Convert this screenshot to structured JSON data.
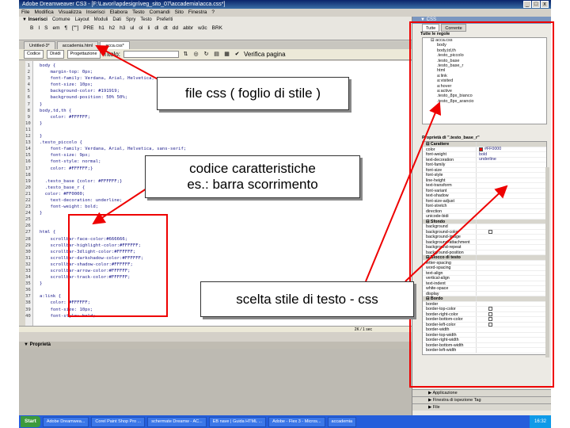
{
  "window": {
    "title": "Adobe Dreamweaver CS3 - [F:\\Lavori\\apdesign\\veg_sito_07\\accademia\\acca.css*]",
    "controls": [
      "_",
      "□",
      "x"
    ]
  },
  "menubar": [
    "File",
    "Modifica",
    "Visualizza",
    "Inserisci",
    "Elabora",
    "Testo",
    "Comandi",
    "Sito",
    "Finestra",
    "?"
  ],
  "insertbar": {
    "title": "▼ Inserisci",
    "tabs": [
      "Comune",
      "Layout",
      "Moduli",
      "Dati",
      "Spry",
      "Testo",
      "Preferiti"
    ],
    "icons": [
      "B",
      "I",
      "S",
      "em",
      "¶",
      "[\"\"]",
      "PRE",
      "h1",
      "h2",
      "h3",
      "ul",
      "ol",
      "li",
      "dl",
      "dt",
      "dd",
      "abbr",
      "w3c",
      "BRK"
    ]
  },
  "doc_tabs": [
    "Untitled-3*",
    "accademia.html",
    "acca.css*"
  ],
  "doc_toolbar": {
    "views": [
      "Codice",
      "Dividi",
      "Progettazione"
    ],
    "title_label": "Titolo:",
    "validate_label": "Verifica pagina"
  },
  "code_lines": [
    {
      "n": "1",
      "t": "body {"
    },
    {
      "n": "2",
      "t": "    margin-top: 0px;"
    },
    {
      "n": "3",
      "t": "    font-family: Verdana, Arial, Helvetica;"
    },
    {
      "n": "4",
      "t": "    font-size: 10px;"
    },
    {
      "n": "5",
      "t": "    background-color: #191919;"
    },
    {
      "n": "6",
      "t": "    background-position: 50% 50%;"
    },
    {
      "n": "7",
      "t": "}"
    },
    {
      "n": "8",
      "t": "body,td,th {"
    },
    {
      "n": "9",
      "t": "    color: #FFFFFF;"
    },
    {
      "n": "10",
      "t": "}"
    },
    {
      "n": "11",
      "t": ""
    },
    {
      "n": "12",
      "t": "}"
    },
    {
      "n": "13",
      "t": ".testo_piccolo {"
    },
    {
      "n": "14",
      "t": "    font-family: Verdana, Arial, Helvetica, sans-serif;"
    },
    {
      "n": "15",
      "t": "    font-size: 9px;"
    },
    {
      "n": "16",
      "t": "    font-style: normal;"
    },
    {
      "n": "17",
      "t": "    color: #FFFFFF;}"
    },
    {
      "n": "18",
      "t": ""
    },
    {
      "n": "19",
      "t": "  .testo_base {color: #FFFFFF;}"
    },
    {
      "n": "20",
      "t": "  .testo_base_r {"
    },
    {
      "n": "21",
      "t": "  color: #FF0000;"
    },
    {
      "n": "22",
      "t": "    text-decoration: underline;"
    },
    {
      "n": "23",
      "t": "    font-weight: bold;"
    },
    {
      "n": "24",
      "t": "}"
    },
    {
      "n": "25",
      "t": ""
    },
    {
      "n": "26",
      "t": ""
    },
    {
      "n": "27",
      "t": "html {"
    },
    {
      "n": "28",
      "t": "    scrollbar-face-color:#666666;"
    },
    {
      "n": "29",
      "t": "    scrollbar-highlight-color:#FFFFFF;"
    },
    {
      "n": "30",
      "t": "    scrollbar-3dlight-color:#FFFFFF;"
    },
    {
      "n": "31",
      "t": "    scrollbar-darkshadow-color:#FFFFFF;"
    },
    {
      "n": "32",
      "t": "    scrollbar-shadow-color:#FFFFFF;"
    },
    {
      "n": "33",
      "t": "    scrollbar-arrow-color:#FFFFFF;"
    },
    {
      "n": "34",
      "t": "    scrollbar-track-color:#FFFFFF;"
    },
    {
      "n": "35",
      "t": "}"
    },
    {
      "n": "36",
      "t": ""
    },
    {
      "n": "37",
      "t": "a:link {"
    },
    {
      "n": "38",
      "t": "    color: #FFFFFF;"
    },
    {
      "n": "39",
      "t": "    font-size: 10px;"
    },
    {
      "n": "40",
      "t": "    font-style: bold;"
    }
  ],
  "status_text": "2K / 1 sec",
  "properties_label": "▼ Proprietà",
  "right_panel": {
    "header": "▼ CSS",
    "tabs": [
      "Tutte",
      "Corrente"
    ],
    "rules_label": "Tutte le regole",
    "tree": [
      {
        "label": "⊟ acca.css",
        "level": 0
      },
      {
        "label": "body",
        "level": 1
      },
      {
        "label": "body,td,th",
        "level": 1
      },
      {
        "label": ".testo_piccolo",
        "level": 1
      },
      {
        "label": ".testo_base",
        "level": 1
      },
      {
        "label": ".testo_base_r",
        "level": 1
      },
      {
        "label": "html",
        "level": 1
      },
      {
        "label": "a:link",
        "level": 1
      },
      {
        "label": "a:visited",
        "level": 1
      },
      {
        "label": "a:hover",
        "level": 1
      },
      {
        "label": "a:active",
        "level": 1
      },
      {
        "label": ".testo_8px_bianco",
        "level": 1
      },
      {
        "label": ".testo_8px_arancio",
        "level": 1
      }
    ],
    "props_label": "Proprietà di \".testo_base_r\"",
    "props": [
      {
        "k": "⊟ Carattere",
        "v": "",
        "cat": true
      },
      {
        "k": "color",
        "v": "#FF0000",
        "swatch": "#ff0000"
      },
      {
        "k": "font-weight",
        "v": "bold"
      },
      {
        "k": "text-decoration",
        "v": "underline"
      },
      {
        "k": "font-family",
        "v": ""
      },
      {
        "k": "font-size",
        "v": ""
      },
      {
        "k": "font-style",
        "v": ""
      },
      {
        "k": "line-height",
        "v": ""
      },
      {
        "k": "text-transform",
        "v": ""
      },
      {
        "k": "font-variant",
        "v": ""
      },
      {
        "k": "text-shadow",
        "v": ""
      },
      {
        "k": "font-size-adjust",
        "v": ""
      },
      {
        "k": "font-stretch",
        "v": ""
      },
      {
        "k": "direction",
        "v": ""
      },
      {
        "k": "unicode-bidi",
        "v": ""
      },
      {
        "k": "⊟ Sfondo",
        "v": "",
        "cat": true
      },
      {
        "k": "background",
        "v": ""
      },
      {
        "k": "background-color",
        "v": "",
        "check": true
      },
      {
        "k": "background-image",
        "v": ""
      },
      {
        "k": "background-attachment",
        "v": ""
      },
      {
        "k": "background-repeat",
        "v": ""
      },
      {
        "k": "background-position",
        "v": ""
      },
      {
        "k": "⊟ Blocco di testo",
        "v": "",
        "cat": true
      },
      {
        "k": "letter-spacing",
        "v": ""
      },
      {
        "k": "word-spacing",
        "v": ""
      },
      {
        "k": "text-align",
        "v": ""
      },
      {
        "k": "vertical-align",
        "v": ""
      },
      {
        "k": "text-indent",
        "v": ""
      },
      {
        "k": "white-space",
        "v": ""
      },
      {
        "k": "display",
        "v": ""
      },
      {
        "k": "⊟ Bordo",
        "v": "",
        "cat": true
      },
      {
        "k": "border",
        "v": ""
      },
      {
        "k": "border-top-color",
        "v": "",
        "check": true
      },
      {
        "k": "border-right-color",
        "v": "",
        "check": true
      },
      {
        "k": "border-bottom-color",
        "v": "",
        "check": true
      },
      {
        "k": "border-left-color",
        "v": "",
        "check": true
      },
      {
        "k": "border-width",
        "v": ""
      },
      {
        "k": "border-top-width",
        "v": ""
      },
      {
        "k": "border-right-width",
        "v": ""
      },
      {
        "k": "border-bottom-width",
        "v": ""
      },
      {
        "k": "border-left-width",
        "v": ""
      }
    ],
    "bottom_panels": [
      "▶ Applicazione",
      "▶ Finestra di ispezione Tag",
      "▶ File"
    ]
  },
  "taskbar": {
    "start": "Start",
    "items": [
      "Adobe Dreamwea...",
      "Corel Paint Shop Pro ...",
      "schermate Dreamw - AC...",
      "EB nave | Guida HTML ...",
      "Adobe - Flex 3 - Micros...",
      "accademia"
    ],
    "clock": "16:32"
  },
  "callouts": {
    "css": "file css ( foglio di stile )",
    "code": "codice  caratteristiche\nes.: barra scorrimento",
    "style": "scelta stile di testo - css"
  },
  "colors": {
    "annotation": "#e00000",
    "code_text": "#1a1a8a",
    "title_bar": "#0a246a"
  }
}
